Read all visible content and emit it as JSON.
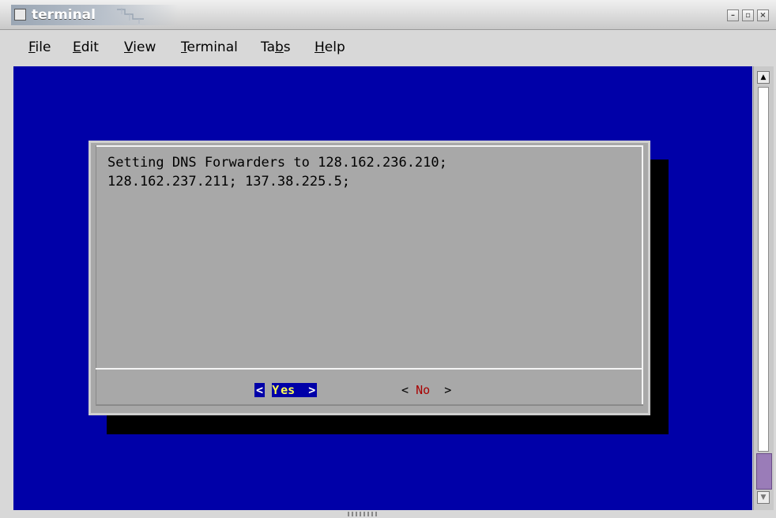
{
  "window": {
    "title": "terminal",
    "buttons": [
      "minimize-icon",
      "maximize-icon",
      "close-icon"
    ]
  },
  "menubar": {
    "items": [
      {
        "label_pre": "",
        "mnemonic": "F",
        "label_post": "ile"
      },
      {
        "label_pre": "",
        "mnemonic": "E",
        "label_post": "dit"
      },
      {
        "label_pre": "",
        "mnemonic": "V",
        "label_post": "iew"
      },
      {
        "label_pre": "",
        "mnemonic": "T",
        "label_post": "erminal"
      },
      {
        "label_pre": "Ta",
        "mnemonic": "b",
        "label_post": "s"
      },
      {
        "label_pre": "",
        "mnemonic": "H",
        "label_post": "elp"
      }
    ]
  },
  "dialog": {
    "message_line1": "Setting DNS Forwarders to 128.162.236.210;",
    "message_line2": "128.162.237.211; 137.38.225.5;",
    "yes": {
      "left": "<",
      "hot": "Y",
      "rest": "es",
      "right": ">"
    },
    "no": {
      "left": "<",
      "hot": "N",
      "rest": "o",
      "right": ">"
    }
  },
  "colors": {
    "terminal_bg": "#0000a8",
    "dialog_bg": "#a8a8a8",
    "hotkey_yellow": "#ffff55",
    "hotkey_red": "#a80000",
    "scroll_thumb": "#9a7cb8"
  }
}
